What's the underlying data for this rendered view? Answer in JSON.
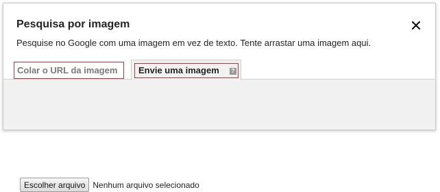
{
  "dialog": {
    "title": "Pesquisa por imagem",
    "subtitle": "Pesquise no Google com uma imagem em vez de texto. Tente arrastar uma imagem aqui.",
    "close_icon": "close-icon"
  },
  "tabs": {
    "url_label": "Colar o URL da imagem",
    "upload_label": "Envie uma imagem",
    "upload_help_icon": "help-icon",
    "active": "upload"
  },
  "upload": {
    "button_label": "Escolher arquivo",
    "status_text": "Nenhum arquivo selecionado"
  },
  "colors": {
    "tab_outline": "#b33a3a",
    "panel_background": "#f1f1f1"
  }
}
